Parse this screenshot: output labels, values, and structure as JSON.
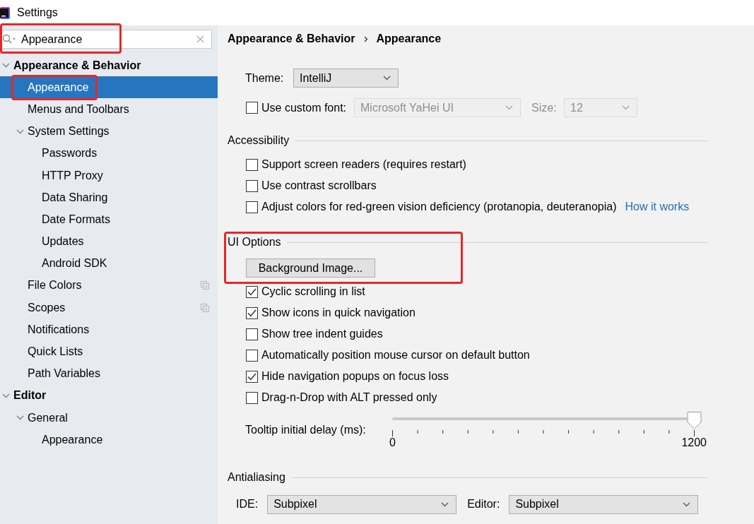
{
  "window": {
    "title": "Settings"
  },
  "sidebar": {
    "search": {
      "value": "Appearance",
      "highlighted": true
    },
    "tree": [
      {
        "label": "Appearance & Behavior",
        "selected": false,
        "highlighted": false,
        "project_icon": false,
        "expanded": true,
        "children": [
          {
            "label": "Appearance",
            "selected": true,
            "highlighted": true,
            "project_icon": false
          },
          {
            "label": "Menus and Toolbars",
            "selected": false,
            "highlighted": false,
            "project_icon": false
          },
          {
            "label": "System Settings",
            "selected": false,
            "highlighted": false,
            "project_icon": false,
            "expanded": true,
            "children": [
              {
                "label": "Passwords",
                "selected": false,
                "highlighted": false,
                "project_icon": false
              },
              {
                "label": "HTTP Proxy",
                "selected": false,
                "highlighted": false,
                "project_icon": false
              },
              {
                "label": "Data Sharing",
                "selected": false,
                "highlighted": false,
                "project_icon": false
              },
              {
                "label": "Date Formats",
                "selected": false,
                "highlighted": false,
                "project_icon": false
              },
              {
                "label": "Updates",
                "selected": false,
                "highlighted": false,
                "project_icon": false
              },
              {
                "label": "Android SDK",
                "selected": false,
                "highlighted": false,
                "project_icon": false
              }
            ]
          },
          {
            "label": "File Colors",
            "selected": false,
            "highlighted": false,
            "project_icon": true
          },
          {
            "label": "Scopes",
            "selected": false,
            "highlighted": false,
            "project_icon": true
          },
          {
            "label": "Notifications",
            "selected": false,
            "highlighted": false,
            "project_icon": false
          },
          {
            "label": "Quick Lists",
            "selected": false,
            "highlighted": false,
            "project_icon": false
          },
          {
            "label": "Path Variables",
            "selected": false,
            "highlighted": false,
            "project_icon": false
          }
        ]
      },
      {
        "label": "Editor",
        "selected": false,
        "highlighted": false,
        "project_icon": false,
        "expanded": true,
        "children": [
          {
            "label": "General",
            "selected": false,
            "highlighted": false,
            "project_icon": false,
            "expanded": true,
            "children": [
              {
                "label": "Appearance",
                "selected": false,
                "highlighted": false,
                "project_icon": false
              }
            ]
          }
        ]
      }
    ]
  },
  "content": {
    "breadcrumb": [
      "Appearance & Behavior",
      "Appearance"
    ],
    "theme": {
      "label": "Theme:",
      "value": "IntelliJ"
    },
    "custom_font": {
      "label": "Use custom font:",
      "checked": false,
      "value": "Microsoft YaHei UI",
      "disabled": true,
      "size_label": "Size:",
      "size": "12"
    },
    "sections": [
      {
        "title": "Accessibility",
        "highlighted": false,
        "items": [
          {
            "kind": "checkbox",
            "label": "Support screen readers (requires restart)",
            "checked": false
          },
          {
            "kind": "checkbox",
            "label": "Use contrast scrollbars",
            "checked": false
          },
          {
            "kind": "checkbox",
            "label": "Adjust colors for red-green vision deficiency (protanopia, deuteranopia)",
            "checked": false,
            "link": "How it works"
          }
        ]
      },
      {
        "title": "UI Options",
        "highlighted": true,
        "items": [
          {
            "kind": "button",
            "label": "Background Image..."
          },
          {
            "kind": "checkbox",
            "label": "Cyclic scrolling in list",
            "checked": true
          },
          {
            "kind": "checkbox",
            "label": "Show icons in quick navigation",
            "checked": true
          },
          {
            "kind": "checkbox",
            "label": "Show tree indent guides",
            "checked": false
          },
          {
            "kind": "checkbox",
            "label": "Automatically position mouse cursor on default button",
            "checked": false
          },
          {
            "kind": "checkbox",
            "label": "Hide navigation popups on focus loss",
            "checked": true
          },
          {
            "kind": "checkbox",
            "label": "Drag-n-Drop with ALT pressed only",
            "checked": false
          },
          {
            "kind": "slider",
            "label": "Tooltip initial delay (ms):",
            "level": 1,
            "min_label": "0",
            "max_label": "1200"
          }
        ]
      },
      {
        "title": "Antialiasing",
        "highlighted": false,
        "items": [
          {
            "kind": "dropdowns",
            "fields": [
              {
                "label": "IDE:",
                "value": "Subpixel"
              },
              {
                "label": "Editor:",
                "value": "Subpixel"
              }
            ]
          }
        ]
      }
    ]
  }
}
